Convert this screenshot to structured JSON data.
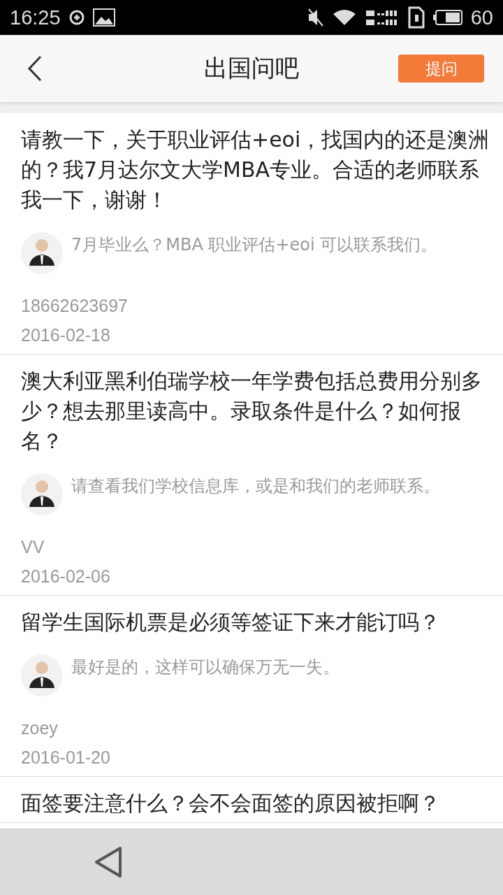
{
  "status_bar": {
    "time": "16:25",
    "battery": "60"
  },
  "header": {
    "title": "出国问吧",
    "action_button": "提问"
  },
  "questions": [
    {
      "question": "请教一下，关于职业评估+eoi，找国内的还是澳洲的？我7月达尔文大学MBA专业。合适的老师联系我一下，谢谢！",
      "answer": "7月毕业么？MBA 职业评估+eoi 可以联系我们。",
      "author": "18662623697",
      "date": "2016-02-18"
    },
    {
      "question": "澳大利亚黑利伯瑞学校一年学费包括总费用分别多少？想去那里读高中。录取条件是什么？如何报名？",
      "answer": "请查看我们学校信息库，或是和我们的老师联系。",
      "author": "VV",
      "date": "2016-02-06"
    },
    {
      "question": "留学生国际机票是必须等签证下来才能订吗？",
      "answer": "最好是的，这样可以确保万无一失。",
      "author": "zoey",
      "date": "2016-01-20"
    },
    {
      "question": "面签要注意什么？会不会面签的原因被拒啊？"
    }
  ]
}
